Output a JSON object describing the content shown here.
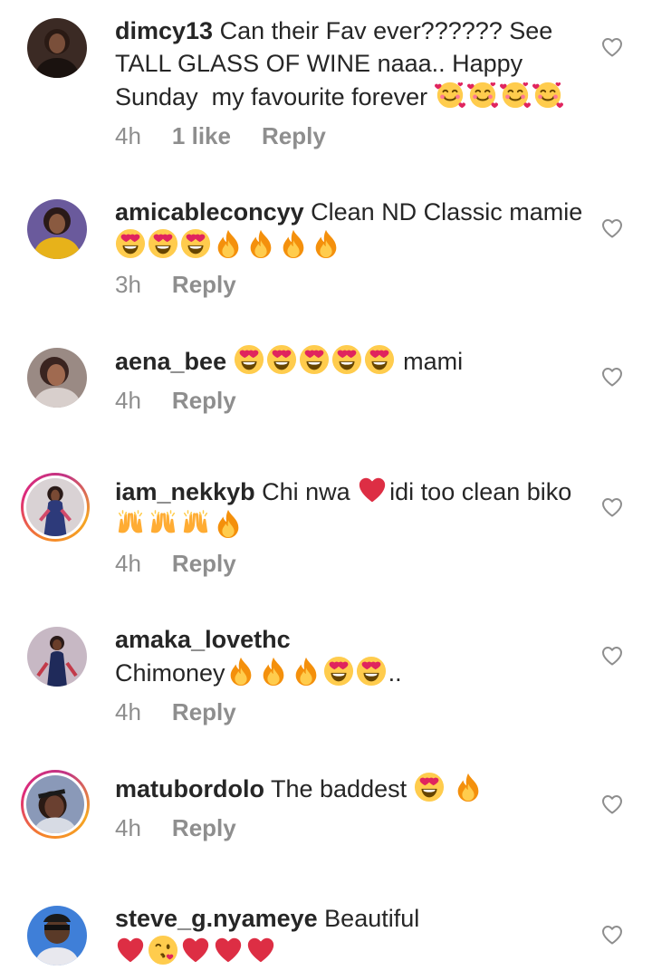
{
  "comments": [
    {
      "username": "dimcy13",
      "text": "Can their Fav ever?????? See TALL GLASS OF WINE naaa.. Happy Sunday  my favourite forever 🥰🥰🥰🥰",
      "time": "4h",
      "likes": "1 like",
      "reply": "Reply"
    },
    {
      "username": "amicableconcyy",
      "text": "Clean ND Classic mamie😍😍😍🔥🔥🔥🔥",
      "time": "3h",
      "reply": "Reply"
    },
    {
      "username": "aena_bee",
      "text": "😍😍😍😍😍 mami",
      "time": "4h",
      "reply": "Reply"
    },
    {
      "username": "iam_nekkyb",
      "text": "Chi nwa ❤️idi too clean biko🙌🙌🙌🔥",
      "time": "4h",
      "reply": "Reply"
    },
    {
      "username": "amaka_lovethc",
      "text": "Chimoney🔥🔥🔥😍😍..",
      "time": "4h",
      "reply": "Reply"
    },
    {
      "username": "matubordolo",
      "text": "The baddest 😍 🔥",
      "time": "4h",
      "reply": "Reply"
    },
    {
      "username": "steve_g.nyameye",
      "text": "Beautiful ❤️😘❤️❤️❤️",
      "time": "",
      "reply": ""
    }
  ],
  "icons": {
    "like": "heart-outline-icon"
  },
  "colors": {
    "text": "#262626",
    "secondary": "#8e8e8e",
    "story_ring_start": "#f58529",
    "story_ring_end": "#dd2a7b"
  }
}
